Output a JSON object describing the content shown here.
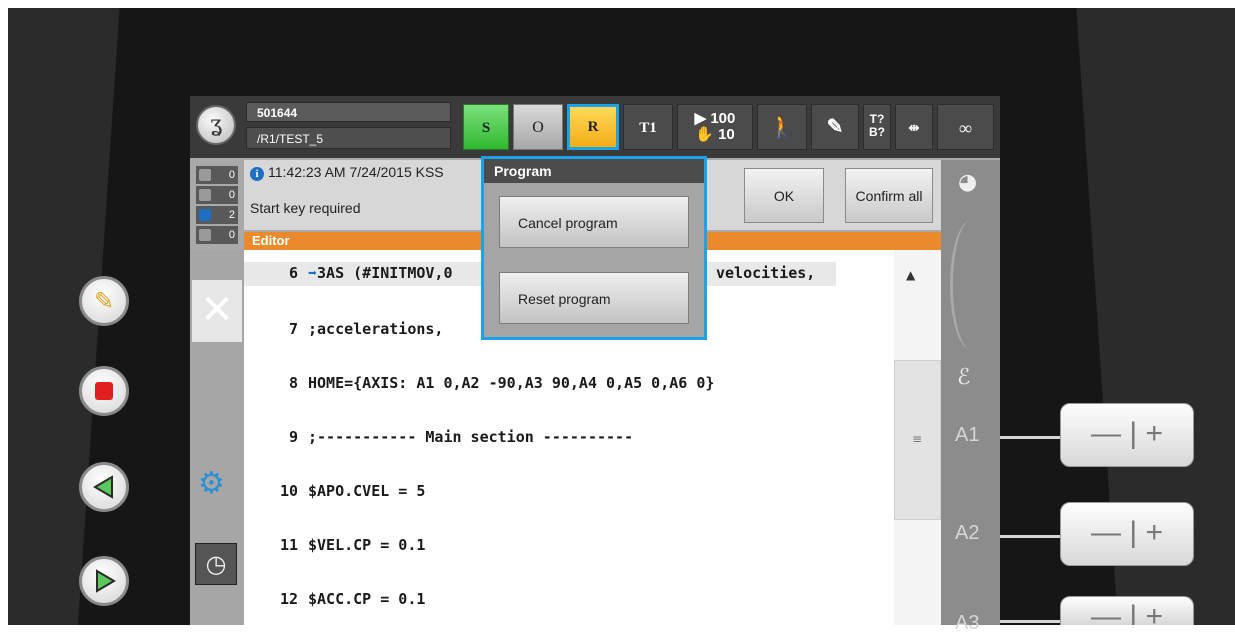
{
  "status_bar": {
    "robot_id": "501644",
    "program_path": "/R1/TEST_5",
    "submit_label": "S",
    "program_state_label": "O",
    "run_mode_label": "R",
    "operating_mode": "T1",
    "program_override": "100",
    "jog_override": "10",
    "tool_base_top": "T?",
    "tool_base_bottom": "B?",
    "incremental_label": "∞",
    "icons": [
      "robot-logo-icon",
      "walking-figure-icon",
      "tool-icon",
      "jog-keys-icon",
      "infinity-icon"
    ]
  },
  "message_window": {
    "counts": [
      "0",
      "0",
      "2",
      "0"
    ],
    "message_time": "11:42:23 AM 7/24/2015 KSS",
    "message_text": "Start key required",
    "ok_label": "OK",
    "confirm_all_label": "Confirm all"
  },
  "editor": {
    "title": "Editor",
    "lines": [
      {
        "num": "6",
        "text": "3AS (#INITMOV,0",
        "text_right": "velocities,",
        "current": true
      },
      {
        "num": "7",
        "text": ";accelerations,"
      },
      {
        "num": "8",
        "text": "HOME={AXIS: A1 0,A2 -90,A3 90,A4 0,A5 0,A6 0}"
      },
      {
        "num": "9",
        "text": ";----------- Main section ----------"
      },
      {
        "num": "10",
        "text": "$APO.CVEL = 5"
      },
      {
        "num": "11",
        "text": "$VEL.CP = 0.1"
      },
      {
        "num": "12",
        "text": "$ACC.CP = 0.1"
      }
    ]
  },
  "program_popup": {
    "title": "Program",
    "cancel_label": "Cancel program",
    "reset_label": "Reset program"
  },
  "jog_panel": {
    "axes": [
      "A1",
      "A2",
      "A3"
    ],
    "minus": "—",
    "plus": "+"
  },
  "colors": {
    "accent_blue": "#1aa3e6",
    "editor_orange": "#ea8a2c",
    "submit_green": "#30b830",
    "run_yellow": "#f3ad16",
    "stop_red": "#e02020"
  }
}
